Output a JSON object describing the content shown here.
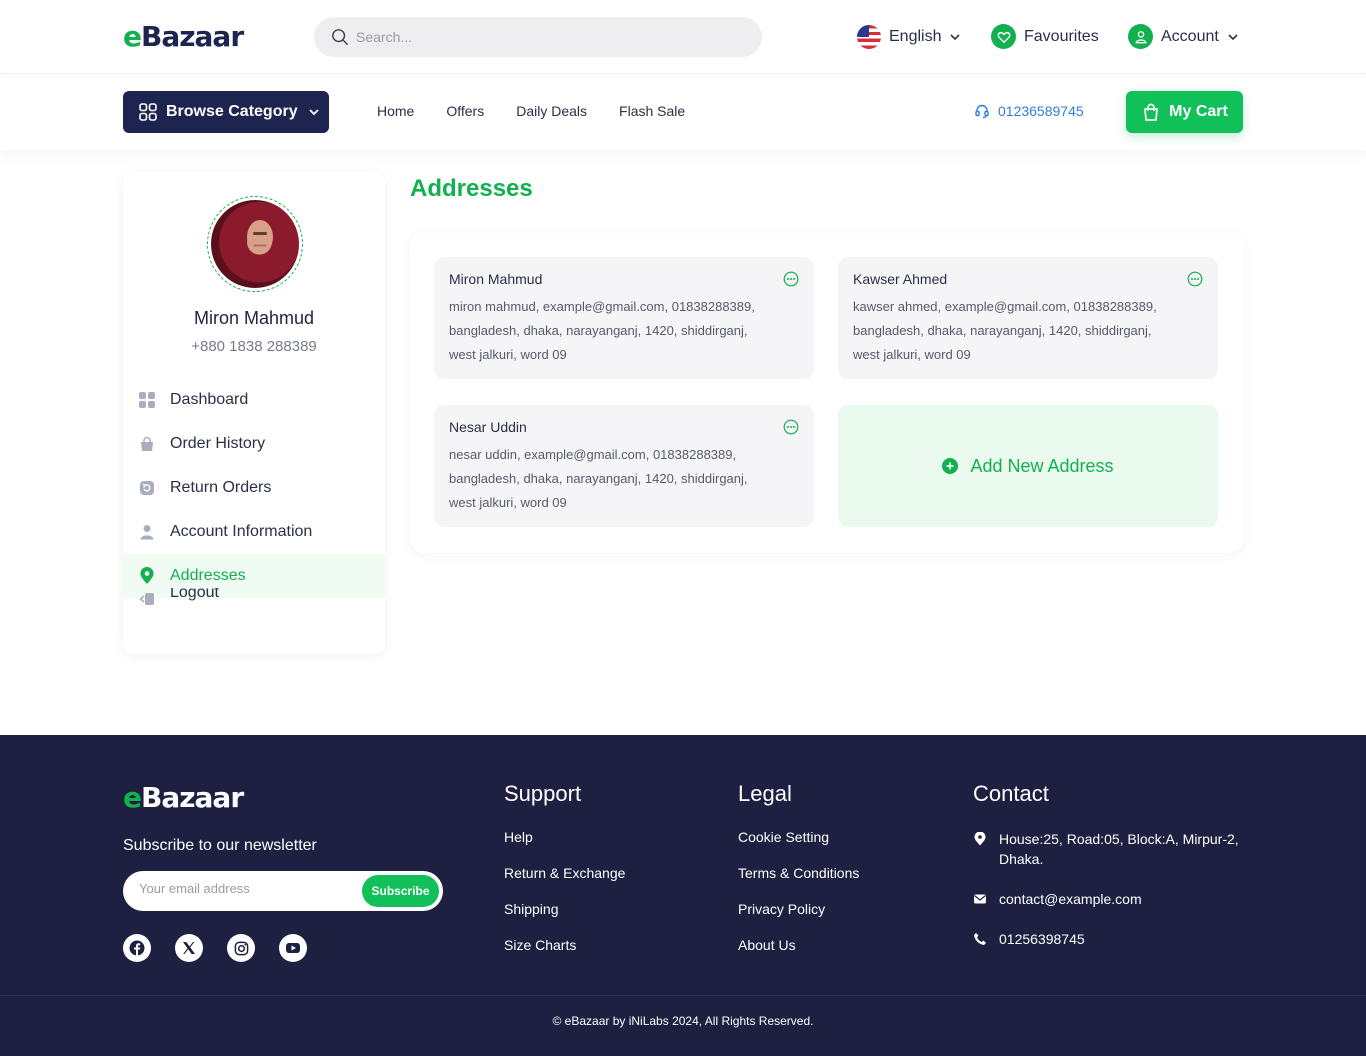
{
  "brand": {
    "logo_e": "e",
    "logo_rest": "Bazaar"
  },
  "header": {
    "search_placeholder": "Search...",
    "language": "English",
    "favourites": "Favourites",
    "account": "Account"
  },
  "nav": {
    "browse_category": "Browse Category",
    "links": [
      "Home",
      "Offers",
      "Daily Deals",
      "Flash Sale"
    ],
    "phone": "01236589745",
    "cart": "My Cart"
  },
  "profile": {
    "name": "Miron Mahmud",
    "phone": "+880 1838 288389"
  },
  "sidebar": {
    "items": [
      {
        "label": "Dashboard",
        "icon": "dashboard-icon",
        "active": false
      },
      {
        "label": "Order History",
        "icon": "shopping-bag-icon",
        "active": false
      },
      {
        "label": "Return Orders",
        "icon": "return-icon",
        "active": false
      },
      {
        "label": "Account Information",
        "icon": "user-icon",
        "active": false
      },
      {
        "label": "Addresses",
        "icon": "location-pin-icon",
        "active": true
      },
      {
        "label": "Logout",
        "icon": "logout-icon",
        "active": false
      }
    ]
  },
  "main": {
    "title": "Addresses",
    "addresses": [
      {
        "name": "Miron Mahmud",
        "address": "miron mahmud, example@gmail.com, 01838288389, bangladesh, dhaka, narayanganj, 1420, shiddirganj, west jalkuri, word 09"
      },
      {
        "name": "Kawser Ahmed",
        "address": "kawser ahmed, example@gmail.com, 01838288389, bangladesh, dhaka, narayanganj, 1420, shiddirganj, west jalkuri, word 09"
      },
      {
        "name": "Nesar Uddin",
        "address": "nesar uddin, example@gmail.com, 01838288389, bangladesh, dhaka, narayanganj, 1420, shiddirganj, west jalkuri, word 09"
      }
    ],
    "add_new": "Add New Address"
  },
  "footer": {
    "newsletter_title": "Subscribe to our newsletter",
    "email_placeholder": "Your email address",
    "subscribe": "Subscribe",
    "support": {
      "title": "Support",
      "links": [
        "Help",
        "Return & Exchange",
        "Shipping",
        "Size Charts"
      ]
    },
    "legal": {
      "title": "Legal",
      "links": [
        "Cookie Setting",
        "Terms & Conditions",
        "Privacy Policy",
        "About Us"
      ]
    },
    "contact": {
      "title": "Contact",
      "address": "House:25, Road:05, Block:A, Mirpur-2, Dhaka.",
      "email": "contact@example.com",
      "phone": "01256398745"
    },
    "copyright": "© eBazaar by iNiLabs 2024, All Rights Reserved."
  },
  "colors": {
    "brand_green": "#12b04e",
    "navy": "#1d2450",
    "footer_bg": "#1d2040",
    "phone_blue": "#2e7fd9"
  }
}
